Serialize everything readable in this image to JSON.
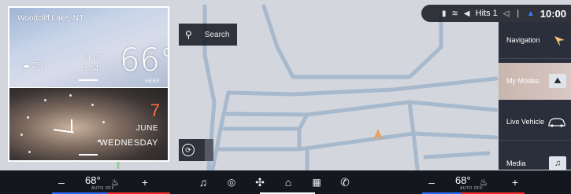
{
  "status_bar": {
    "media_source": "Hits 1",
    "clock": "10:00"
  },
  "weather": {
    "location": "Woodcliff Lake, NJ",
    "rain_chance": "2%",
    "high": "H 73°",
    "low": "L 54°",
    "temperature": "66°",
    "source": "HERE"
  },
  "date": {
    "day": "7",
    "month": "JUNE",
    "weekday": "WEDNESDAY"
  },
  "search": {
    "label": "Search"
  },
  "right_menu": {
    "items": [
      {
        "label": "Navigation",
        "icon": "navigation-arrow-icon"
      },
      {
        "label": "My Modes",
        "icon": "mountain-icon"
      },
      {
        "label": "Live Vehicle",
        "icon": "car-icon"
      },
      {
        "label": "Media",
        "icon": "music-note-icon"
      }
    ]
  },
  "climate": {
    "left_temp": "68°",
    "left_mode": "AUTO OFF",
    "right_temp": "68°",
    "right_mode": "AUTO OFF",
    "minus": "–",
    "plus": "+"
  },
  "colors": {
    "accent_orange": "#ff6a3a",
    "driver_side": "#2d6cff",
    "passenger_side": "#ff2b2b",
    "vehicle_marker": "#e8a05a"
  }
}
